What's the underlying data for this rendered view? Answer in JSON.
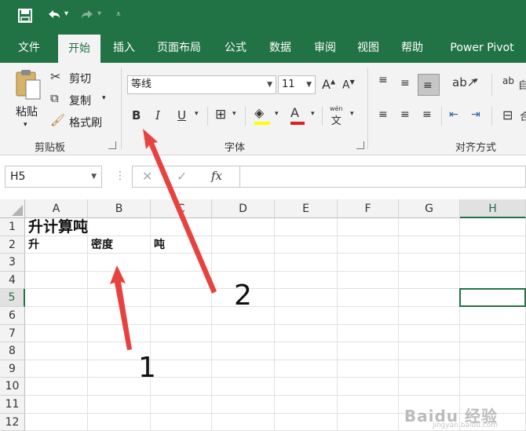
{
  "quick_access": {
    "save_icon": "save-icon",
    "undo_icon": "undo-icon",
    "redo_icon": "redo-icon",
    "customize_icon": "customize-icon"
  },
  "tabs": [
    {
      "label": "文件"
    },
    {
      "label": "开始"
    },
    {
      "label": "插入"
    },
    {
      "label": "页面布局"
    },
    {
      "label": "公式"
    },
    {
      "label": "数据"
    },
    {
      "label": "审阅"
    },
    {
      "label": "视图"
    },
    {
      "label": "帮助"
    },
    {
      "label": "Power Pivot"
    }
  ],
  "ribbon": {
    "clipboard": {
      "paste": "粘贴",
      "cut": "剪切",
      "copy": "复制",
      "format_painter": "格式刷",
      "group": "剪贴板"
    },
    "font": {
      "font_name": "等线",
      "font_size": "11",
      "bold": "B",
      "italic": "I",
      "underline": "U",
      "phonetic": "wén",
      "group": "字体",
      "font_color_label": "A"
    },
    "alignment": {
      "group": "对齐方式",
      "wrap": "自",
      "merge": "合"
    }
  },
  "formula_bar": {
    "name_box": "H5",
    "fx": "fx",
    "value": ""
  },
  "columns": [
    "A",
    "B",
    "C",
    "D",
    "E",
    "F",
    "G",
    "H"
  ],
  "rows": [
    "1",
    "2",
    "3",
    "4",
    "5",
    "6",
    "7",
    "8",
    "9",
    "10",
    "11",
    "12"
  ],
  "cells": {
    "A1": "升计算吨",
    "A2": "升",
    "B2": "密度",
    "C2": "吨"
  },
  "selected_cell": "H5",
  "annotations": {
    "one": "1",
    "two": "2"
  },
  "watermark": {
    "text": "Baidu 经验",
    "sub": "jingyan.baidu.com"
  },
  "colors": {
    "accent": "#217346",
    "arrow": "#e8423f"
  }
}
